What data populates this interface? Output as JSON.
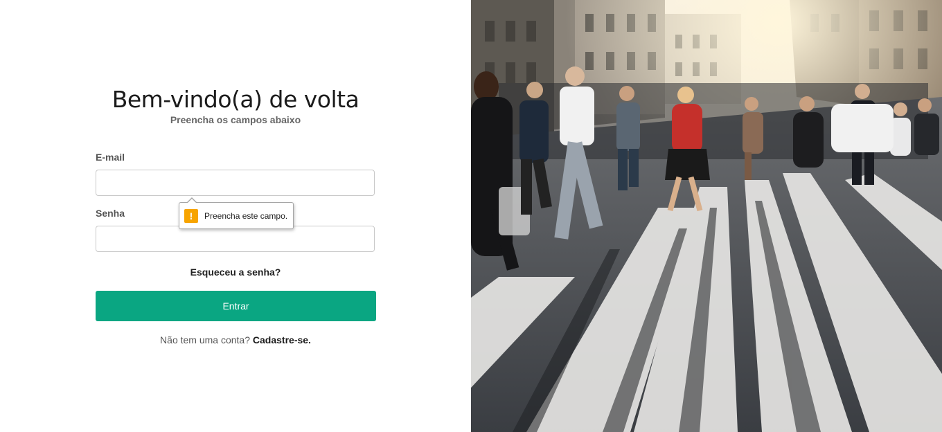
{
  "login": {
    "title": "Bem-vindo(a) de volta",
    "subtitle": "Preencha os campos abaixo",
    "email_label": "E-mail",
    "email_value": "",
    "password_label": "Senha",
    "password_value": "",
    "forgot_link": "Esqueceu a senha?",
    "submit_label": "Entrar",
    "signup_prompt": "Não tem uma conta?",
    "signup_link": "Cadastre-se."
  },
  "validation_tooltip": {
    "icon": "warning-icon",
    "message": "Preencha este campo."
  },
  "hero_image": {
    "subject": "crowd-crossing-street-photo"
  },
  "colors": {
    "primary_button": "#0aa682",
    "warning": "#f7a400"
  }
}
